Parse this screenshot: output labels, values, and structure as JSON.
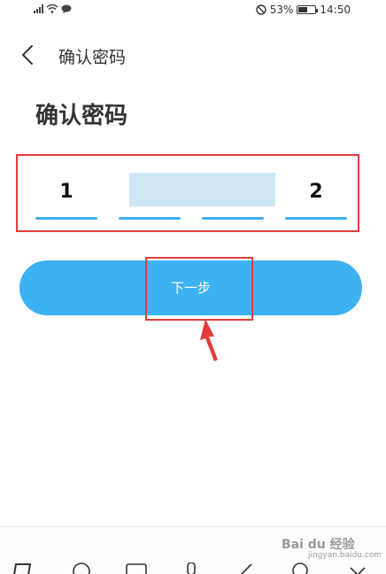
{
  "status_bar": {
    "battery_percent": "53%",
    "time": "14:50"
  },
  "nav": {
    "title": "确认密码"
  },
  "page": {
    "heading": "确认密码"
  },
  "code_input": {
    "digits": [
      "1",
      "",
      "",
      "2"
    ]
  },
  "actions": {
    "next_label": "下一步"
  },
  "watermark": {
    "brand": "Bai du 经验",
    "sub": "jingyan.baidu.com"
  },
  "colors": {
    "accent": "#3db2f2",
    "annotation": "#e23c3c",
    "highlight": "#cde8f2"
  }
}
